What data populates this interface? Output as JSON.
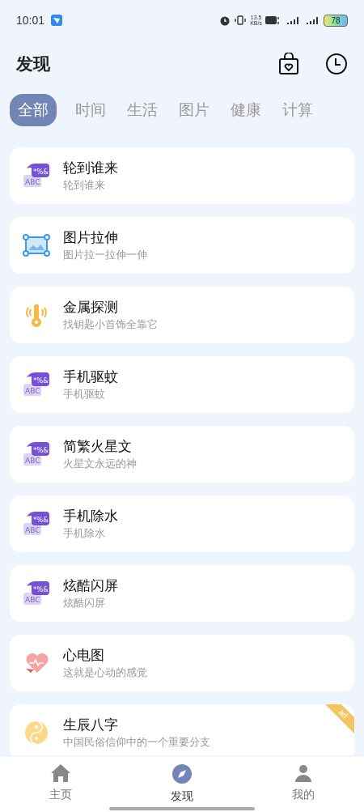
{
  "status_bar": {
    "time": "10:01",
    "network_speed": "13.5",
    "network_unit": "KB/s",
    "battery": "78"
  },
  "header": {
    "title": "发现"
  },
  "tabs": [
    {
      "label": "全部",
      "selected": true
    },
    {
      "label": "时间",
      "selected": false
    },
    {
      "label": "生活",
      "selected": false
    },
    {
      "label": "图片",
      "selected": false
    },
    {
      "label": "健康",
      "selected": false
    },
    {
      "label": "计算",
      "selected": false
    }
  ],
  "tools": [
    {
      "kind": "symbols",
      "icon_top": "*%&",
      "icon_bottom": "ABC",
      "title": "轮到谁来",
      "subtitle": "轮到谁来"
    },
    {
      "kind": "image",
      "title": "图片拉伸",
      "subtitle": "图片拉一拉伸一伸"
    },
    {
      "kind": "metal",
      "title": "金属探测",
      "subtitle": "找钥匙小首饰全靠它"
    },
    {
      "kind": "symbols",
      "icon_top": "*%&",
      "icon_bottom": "ABC",
      "title": "手机驱蚊",
      "subtitle": "手机驱蚊"
    },
    {
      "kind": "symbols",
      "icon_top": "*%&",
      "icon_bottom": "ABC",
      "title": "简繁火星文",
      "subtitle": "火星文永远的神"
    },
    {
      "kind": "symbols",
      "icon_top": "*%&",
      "icon_bottom": "ABC",
      "title": "手机除水",
      "subtitle": "手机除水"
    },
    {
      "kind": "symbols",
      "icon_top": "*%&",
      "icon_bottom": "ABC",
      "title": "炫酷闪屏",
      "subtitle": "炫酷闪屏"
    },
    {
      "kind": "heart",
      "title": "心电图",
      "subtitle": "这就是心动的感觉"
    },
    {
      "kind": "taiji",
      "title": "生辰八字",
      "subtitle": "中国民俗信仰中的一个重要分支",
      "ad": "ad"
    }
  ],
  "bottom_nav": [
    {
      "kind": "home",
      "label": "主页",
      "selected": false
    },
    {
      "kind": "compass",
      "label": "发现",
      "selected": true
    },
    {
      "kind": "person",
      "label": "我的",
      "selected": false
    }
  ]
}
